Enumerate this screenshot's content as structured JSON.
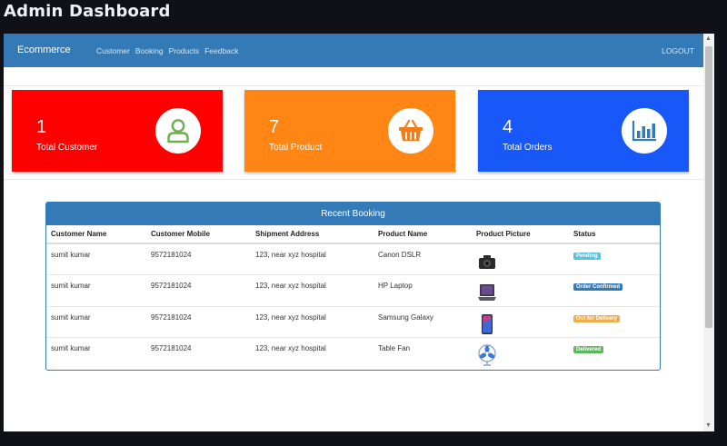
{
  "window": {
    "title": "Admin Dashboard"
  },
  "navbar": {
    "brand": "Ecommerce",
    "links": [
      "Customer",
      "Booking",
      "Products",
      "Feedback"
    ],
    "logout": "LOGOUT"
  },
  "stats": [
    {
      "value": "1",
      "label": "Total Customer",
      "color": "#ff0000",
      "icon": "user-icon"
    },
    {
      "value": "7",
      "label": "Total Product",
      "color": "#ff8614",
      "icon": "basket-icon"
    },
    {
      "value": "4",
      "label": "Total Orders",
      "color": "#1858f8",
      "icon": "bar-chart-icon"
    }
  ],
  "booking": {
    "title": "Recent Booking",
    "columns": [
      "Customer Name",
      "Customer Mobile",
      "Shipment Address",
      "Product Name",
      "Product Picture",
      "Status"
    ],
    "rows": [
      {
        "customer": "sumit kumar",
        "mobile": "9572181024",
        "address": "123, near xyz hospital",
        "product": "Canon DSLR",
        "picture": "camera-image",
        "status": "Pending",
        "status_color": "#5bc0de"
      },
      {
        "customer": "sumit kumar",
        "mobile": "9572181024",
        "address": "123, near xyz hospital",
        "product": "HP Laptop",
        "picture": "laptop-image",
        "status": "Order Confirmed",
        "status_color": "#337ab7"
      },
      {
        "customer": "sumit kumar",
        "mobile": "9572181024",
        "address": "123, near xyz hospital",
        "product": "Samsung Galaxy",
        "picture": "phone-image",
        "status": "Out for Delivery",
        "status_color": "#f0ad4e"
      },
      {
        "customer": "sumit kumar",
        "mobile": "9572181024",
        "address": "123, near xyz hospital",
        "product": "Table Fan",
        "picture": "fan-image",
        "status": "Delivered",
        "status_color": "#5cb85c"
      }
    ]
  }
}
